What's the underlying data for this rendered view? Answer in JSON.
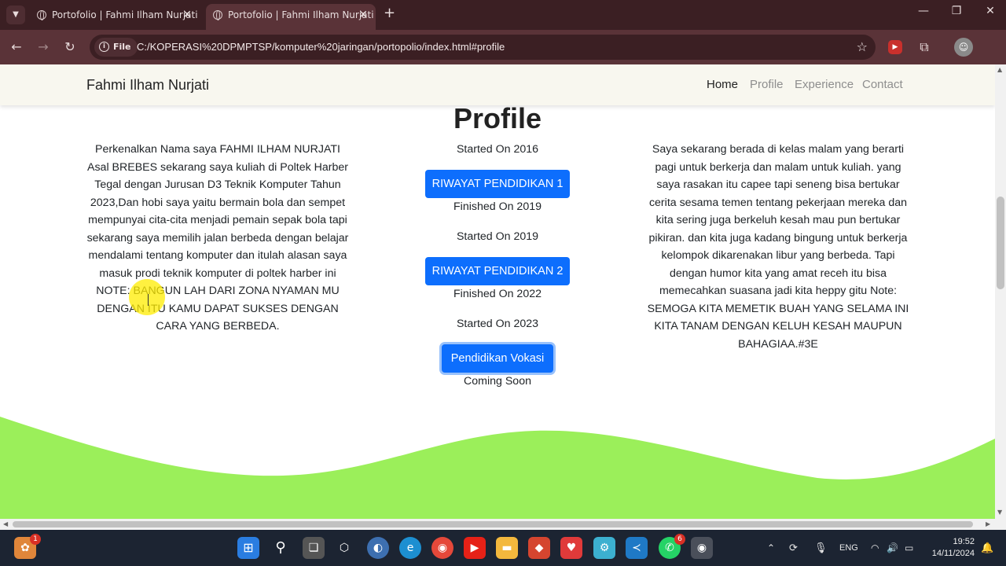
{
  "browser": {
    "tabs": [
      {
        "title": "Portofolio | Fahmi Ilham Nurjati",
        "active": false
      },
      {
        "title": "Portofolio | Fahmi Ilham Nurjati",
        "active": true
      }
    ],
    "url_chip": "File",
    "url": "C:/KOPERASI%20DPMPTSP/komputer%20jaringan/portopolio/index.html#profile"
  },
  "page": {
    "brand": "Fahmi Ilham Nurjati",
    "nav": [
      "Home",
      "Profile",
      "Experience",
      "Contact"
    ],
    "title": "Profile",
    "left_text": "Perkenalkan Nama saya FAHMI ILHAM NURJATI Asal BREBES sekarang saya kuliah di Poltek Harber Tegal dengan Jurusan D3 Teknik Komputer Tahun 2023,Dan hobi saya yaitu bermain bola dan sempet mempunyai cita-cita menjadi pemain sepak bola tapi sekarang saya memilih jalan berbeda dengan belajar mendalami tentang komputer dan itulah alasan saya masuk prodi teknik komputer di poltek harber ini NOTE: BANGUN LAH DARI ZONA NYAMAN MU DENGAN ITU KAMU DAPAT SUKSES DENGAN CARA YANG BERBEDA.",
    "right_text": "Saya sekarang berada di kelas malam yang berarti pagi untuk berkerja dan malam untuk kuliah. yang saya rasakan itu capee tapi seneng bisa bertukar cerita sesama temen tentang pekerjaan mereka dan kita sering juga berkeluh kesah mau pun bertukar pikiran. dan kita juga kadang bingung untuk berkerja kelompok dikarenakan libur yang berbeda. Tapi dengan humor kita yang amat receh itu bisa memecahkan suasana jadi kita heppy gitu Note: SEMOGA KITA MEMETIK BUAH YANG SELAMA INI KITA TANAM DENGAN KELUH KESAH MAUPUN BAHAGIAA.#3E",
    "timeline": [
      {
        "start": "Started On 2016",
        "button": "RIWAYAT PENDIDIKAN 1",
        "end": "Finished On 2019"
      },
      {
        "start": "Started On 2019",
        "button": "RIWAYAT PENDIDIKAN 2",
        "end": "Finished On 2022"
      },
      {
        "start": "Started On 2023",
        "button": "Pendidikan Vokasi",
        "end": "Coming Soon"
      }
    ],
    "wave_color": "#9bef5a",
    "accent_color": "#0d6efd"
  },
  "taskbar": {
    "badges": {
      "explorer": "1",
      "whatsapp": "6"
    },
    "lang": "ENG",
    "time": "19:52",
    "date": "14/11/2024"
  }
}
